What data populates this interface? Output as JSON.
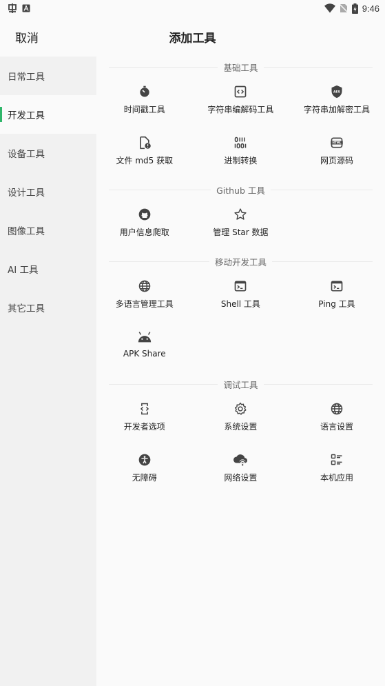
{
  "status_bar": {
    "time": "9:46"
  },
  "header": {
    "cancel": "取消",
    "title": "添加工具"
  },
  "sidebar": {
    "items": [
      {
        "label": "日常工具",
        "active": false
      },
      {
        "label": "开发工具",
        "active": true
      },
      {
        "label": "设备工具",
        "active": false
      },
      {
        "label": "设计工具",
        "active": false
      },
      {
        "label": "图像工具",
        "active": false
      },
      {
        "label": "AI 工具",
        "active": false
      },
      {
        "label": "其它工具",
        "active": false
      }
    ]
  },
  "sections": [
    {
      "title": "基础工具",
      "tools": [
        {
          "label": "时间戳工具",
          "icon": "timer-icon"
        },
        {
          "label": "字符串编解码工具",
          "icon": "code-box-icon"
        },
        {
          "label": "字符串加解密工具",
          "icon": "aes-shield-icon"
        },
        {
          "label": "文件 md5 获取",
          "icon": "file-alert-icon"
        },
        {
          "label": "进制转换",
          "icon": "binary-icon"
        },
        {
          "label": "网页源码",
          "icon": "html-icon"
        }
      ]
    },
    {
      "title": "Github 工具",
      "tools": [
        {
          "label": "用户信息爬取",
          "icon": "github-icon"
        },
        {
          "label": "管理 Star 数据",
          "icon": "star-icon"
        }
      ]
    },
    {
      "title": "移动开发工具",
      "tools": [
        {
          "label": "多语言管理工具",
          "icon": "globe-icon"
        },
        {
          "label": "Shell 工具",
          "icon": "terminal-icon"
        },
        {
          "label": "Ping 工具",
          "icon": "terminal-icon"
        },
        {
          "label": "APK Share",
          "icon": "android-icon"
        }
      ]
    },
    {
      "title": "调试工具",
      "tools": [
        {
          "label": "开发者选项",
          "icon": "developer-mode-icon"
        },
        {
          "label": "系统设置",
          "icon": "settings-icon"
        },
        {
          "label": "语言设置",
          "icon": "globe-icon"
        },
        {
          "label": "无障碍",
          "icon": "accessibility-icon"
        },
        {
          "label": "网络设置",
          "icon": "wifi-cloud-icon"
        },
        {
          "label": "本机应用",
          "icon": "app-list-icon"
        }
      ]
    }
  ],
  "colors": {
    "accent": "#2fb66a",
    "sidebar_bg": "#f1f1f1",
    "content_bg": "#fafafa",
    "icon": "#444444"
  }
}
